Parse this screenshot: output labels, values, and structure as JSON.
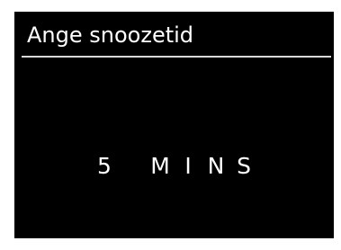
{
  "menu": {
    "title": "Ange snoozetid"
  },
  "snooze": {
    "value": "5",
    "unit": "MINS",
    "display_chars": [
      "5",
      " ",
      "M",
      "I",
      "N",
      "S"
    ]
  },
  "colors": {
    "screen_background": "#000000",
    "text": "#ffffff",
    "divider": "#d9d9d9"
  }
}
